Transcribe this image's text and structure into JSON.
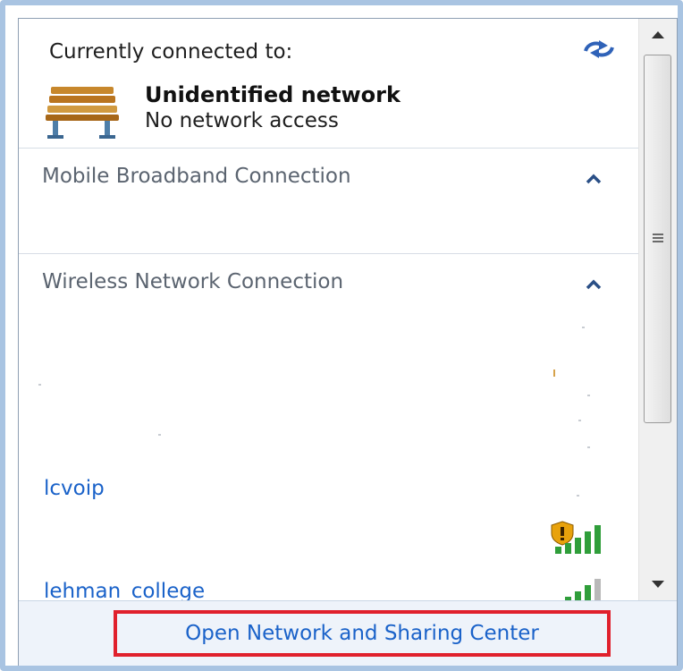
{
  "current": {
    "heading": "Currently connected to:",
    "network_name": "Unidentified network",
    "network_status": "No network access",
    "icon": "bench-icon"
  },
  "sections": [
    {
      "label": "Mobile Broadband Connection",
      "expanded": true
    },
    {
      "label": "Wireless Network Connection",
      "expanded": true
    }
  ],
  "networks": [
    {
      "name": "lcvoip",
      "signal_bars": 5,
      "secured": false,
      "icon": "signal-shield-icon"
    },
    {
      "name": "lehman_college",
      "signal_bars": 4,
      "secured": true,
      "icon": "signal-bars-icon"
    }
  ],
  "footer": {
    "link_label": "Open Network and Sharing Center",
    "highlight_color": "#e0202c"
  },
  "colors": {
    "link": "#1a62c9",
    "frame": "#a9c4e2",
    "footer_bg": "#eef3fa"
  }
}
